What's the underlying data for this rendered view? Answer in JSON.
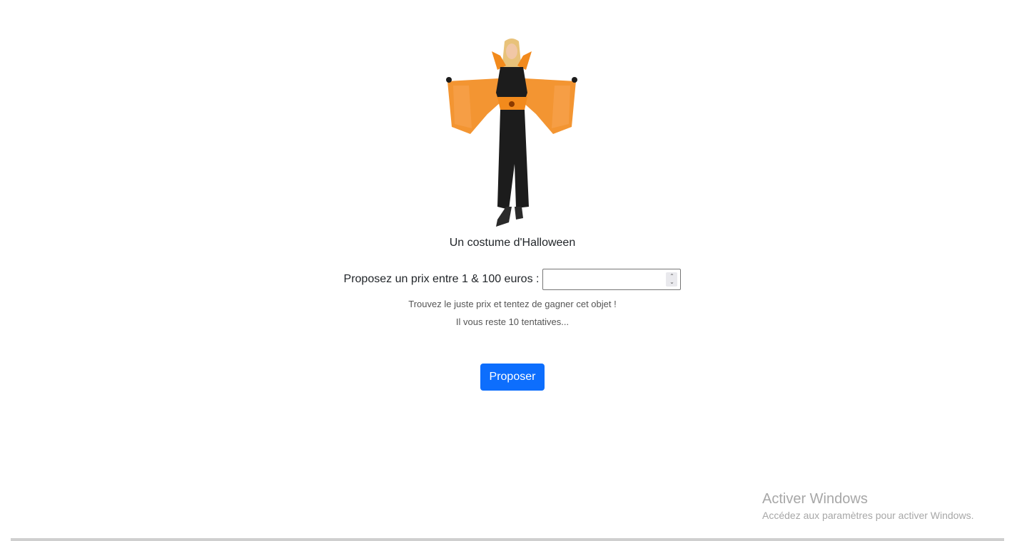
{
  "product": {
    "title": "Un costume d'Halloween",
    "image_icon": "halloween-costume-photo"
  },
  "form": {
    "price_label": "Proposez un prix entre 1 & 100 euros :",
    "price_value": "",
    "help_text": "Trouvez le juste prix et tentez de gagner cet objet !",
    "attempts_text": "Il vous reste 10 tentatives...",
    "submit_label": "Proposer"
  },
  "system": {
    "watermark_title": "Activer Windows",
    "watermark_subtitle": "Accédez aux paramètres pour activer Windows."
  },
  "colors": {
    "primary": "#0d6efd",
    "costume_orange": "#f28a1c",
    "costume_black": "#1c1c1c"
  }
}
